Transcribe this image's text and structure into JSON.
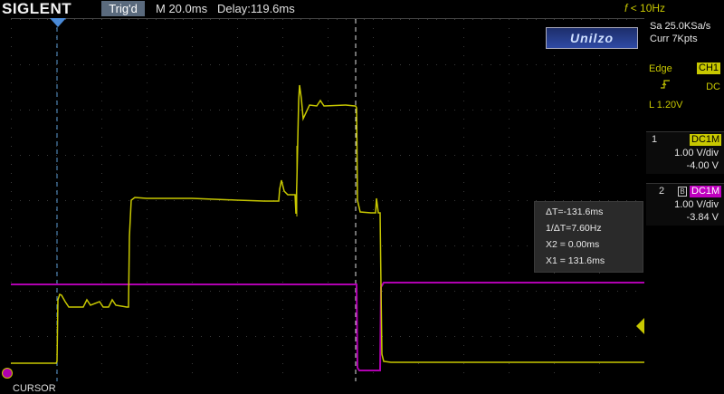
{
  "header": {
    "brand": "SIGLENT",
    "trigger_status": "Trig'd",
    "timebase": "M 20.0ms",
    "delay": "Delay:119.6ms",
    "freq_symbol": "f",
    "freq_value": "< 10Hz"
  },
  "watermark": "Unilzo",
  "acquisition": {
    "sample_rate": "Sa 25.0KSa/s",
    "memory": "Curr 7Kpts"
  },
  "trigger": {
    "type": "Edge",
    "source": "CH1",
    "coupling": "DC",
    "level": "L  1.20V",
    "color": "#c8c800"
  },
  "channels": [
    {
      "num": "1",
      "coupling": "DC1M",
      "scale": "1.00 V/div",
      "offset": "-4.00 V",
      "color": "#c8c800"
    },
    {
      "num": "2",
      "coupling": "DC1M",
      "scale": "1.00 V/div",
      "offset": "-3.84 V",
      "color": "#c000c0"
    }
  ],
  "cursor": {
    "delta_t": "ΔT=-131.6ms",
    "inv_delta_t": "1/ΔT=7.60Hz",
    "x2": "X2 = 0.00ms",
    "x1": "X1 = 131.6ms"
  },
  "footer": {
    "mode": "CURSOR"
  },
  "colors": {
    "ch1": "#c8c800",
    "ch2": "#b000b0",
    "cursor_x1": "#5b9bd5",
    "cursor_x2": "#e0e0e0",
    "trig_badge": "#5a6a7d"
  }
}
